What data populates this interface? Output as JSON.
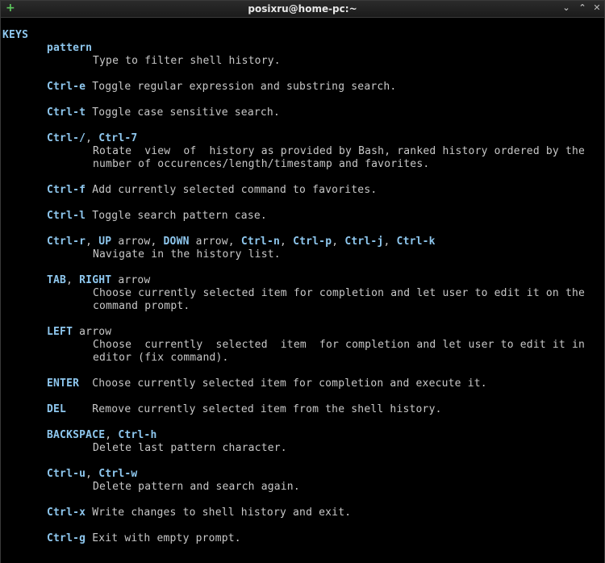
{
  "window": {
    "title": "posixru@home-pc:~",
    "new_tab_glyph": "+",
    "minimize_glyph": "⌄",
    "maximize_glyph": "⌃",
    "close_glyph": "✕"
  },
  "man": {
    "section": "KEYS",
    "pattern_key": "pattern",
    "pattern_desc": "Type to filter shell history.",
    "ctrl_e_key": "Ctrl-e",
    "ctrl_e_desc": " Toggle regular expression and substring search.",
    "ctrl_t_key": "Ctrl-t",
    "ctrl_t_desc": " Toggle case sensitive search.",
    "rotate_key_a": "Ctrl-/",
    "rotate_sep": ", ",
    "rotate_key_b": "Ctrl-7",
    "rotate_desc_1": "Rotate  view  of  history as provided by Bash, ranked history ordered by the",
    "rotate_desc_2": "number of occurences/length/timestamp and favorites.",
    "ctrl_f_key": "Ctrl-f",
    "ctrl_f_desc": " Add currently selected command to favorites.",
    "ctrl_l_key": "Ctrl-l",
    "ctrl_l_desc": " Toggle search pattern case.",
    "nav_keys": {
      "k1": "Ctrl-r",
      "s1": ", ",
      "k2": "UP",
      "s2": " arrow, ",
      "k3": "DOWN",
      "s3": " arrow, ",
      "k4": "Ctrl-n",
      "s4": ", ",
      "k5": "Ctrl-p",
      "s5": ", ",
      "k6": "Ctrl-j",
      "s6": ", ",
      "k7": "Ctrl-k"
    },
    "nav_desc": "Navigate in the history list.",
    "tab_key_a": "TAB",
    "tab_sep": ", ",
    "tab_key_b": "RIGHT",
    "tab_suffix": " arrow",
    "tab_desc_1": "Choose currently selected item for completion and let user to edit it on the",
    "tab_desc_2": "command prompt.",
    "left_key": "LEFT",
    "left_suffix": " arrow",
    "left_desc_1": "Choose  currently  selected  item  for completion and let user to edit it in",
    "left_desc_2": "editor (fix command).",
    "enter_key": "ENTER",
    "enter_desc": "  Choose currently selected item for completion and execute it.",
    "del_key": "DEL",
    "del_desc": "    Remove currently selected item from the shell history.",
    "backspace_key": "BACKSPACE",
    "backspace_sep": ", ",
    "backspace_key_b": "Ctrl-h",
    "backspace_desc": "Delete last pattern character.",
    "ctrl_u_key": "Ctrl-u",
    "ctrl_u_sep": ", ",
    "ctrl_w_key": "Ctrl-w",
    "ctrl_uw_desc": "Delete pattern and search again.",
    "ctrl_x_key": "Ctrl-x",
    "ctrl_x_desc": " Write changes to shell history and exit.",
    "ctrl_g_key": "Ctrl-g",
    "ctrl_g_desc": " Exit with empty prompt."
  }
}
